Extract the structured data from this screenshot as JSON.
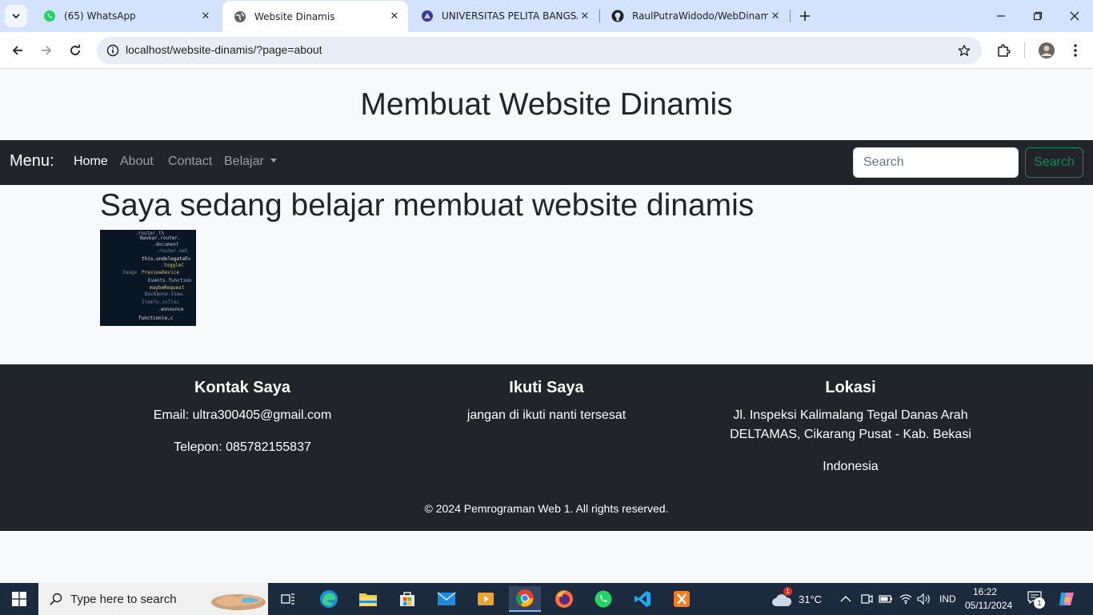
{
  "browser": {
    "tabs": [
      {
        "title": "(65) WhatsApp",
        "favicon": "whatsapp-icon"
      },
      {
        "title": "Website Dinamis",
        "favicon": "globe-icon",
        "active": true
      },
      {
        "title": "UNIVERSITAS PELITA BANGSA",
        "favicon": "university-icon"
      },
      {
        "title": "RaulPutraWidodo/WebDinamis",
        "favicon": "github-icon"
      }
    ],
    "url": "localhost/website-dinamis/?page=about"
  },
  "page": {
    "header_title": "Membuat Website Dinamis",
    "navbar": {
      "brand": "Menu:",
      "links": [
        "Home",
        "About",
        "Contact",
        "Belajar"
      ],
      "search_placeholder": "Search",
      "search_button": "Search"
    },
    "content_title": "Saya sedang belajar membuat website dinamis",
    "footer": {
      "contact": {
        "heading": "Kontak Saya",
        "email": "Email: ultra300405@gmail.com",
        "phone": "Telepon: 085782155837"
      },
      "follow": {
        "heading": "Ikuti Saya",
        "text": "jangan di ikuti nanti tersesat"
      },
      "location": {
        "heading": "Lokasi",
        "address_line1": "Jl. Inspeksi Kalimalang Tegal Danas Arah",
        "address_line2": "DELTAMAS, Cikarang Pusat - Kab. Bekasi",
        "country": "Indonesia"
      },
      "copyright": "© 2024 Pemrograman Web 1. All rights reserved."
    }
  },
  "taskbar": {
    "search_placeholder": "Type here to search",
    "weather": "31°C",
    "weather_badge": "1",
    "language": "IND",
    "time": "16:22",
    "date": "05/11/2024",
    "notification_count": "1"
  }
}
